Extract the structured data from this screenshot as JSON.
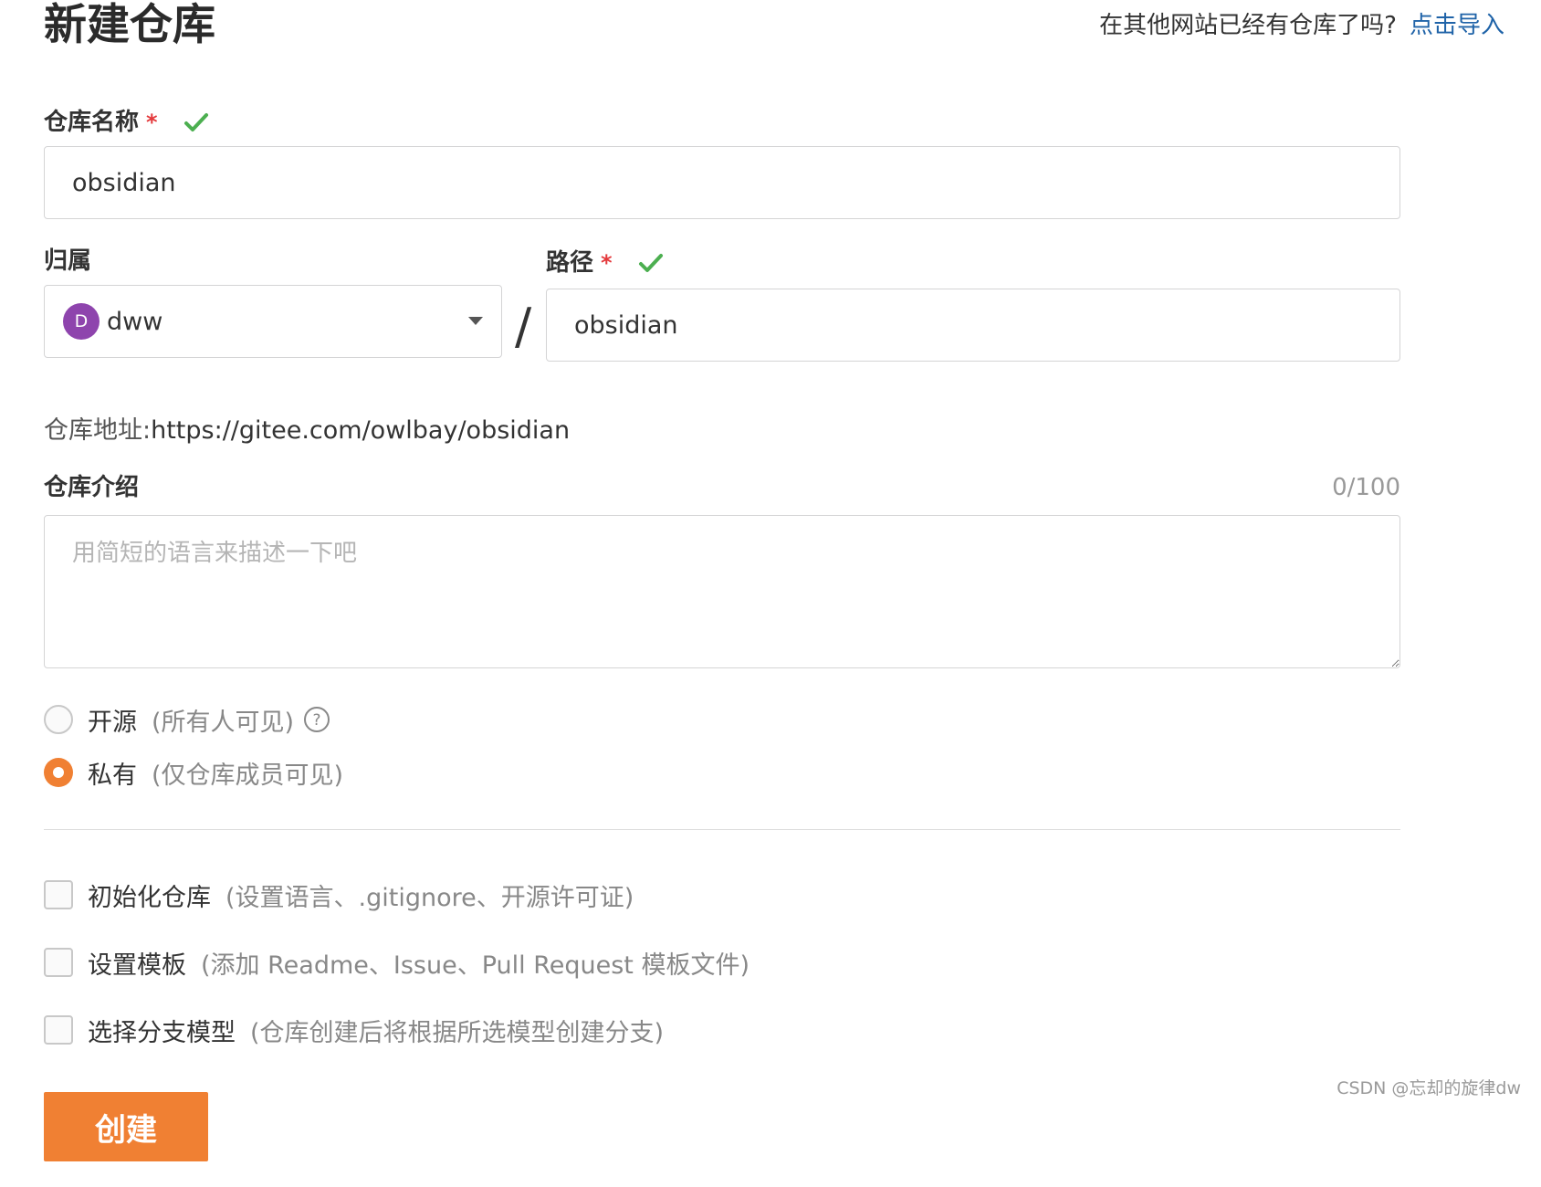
{
  "header": {
    "title": "新建仓库",
    "import_question": "在其他网站已经有仓库了吗?",
    "import_link": "点击导入"
  },
  "repo_name": {
    "label": "仓库名称",
    "required_mark": "*",
    "value": "obsidian",
    "valid_icon": "check-icon"
  },
  "owner": {
    "label": "归属",
    "avatar_letter": "D",
    "avatar_color": "#8e44ad",
    "selected": "dww"
  },
  "separator": "/",
  "path": {
    "label": "路径",
    "required_mark": "*",
    "value": "obsidian",
    "valid_icon": "check-icon"
  },
  "repo_address": {
    "label": "仓库地址:",
    "url": "https://gitee.com/owlbay/obsidian"
  },
  "description": {
    "label": "仓库介绍",
    "counter": "0/100",
    "placeholder": "用简短的语言来描述一下吧"
  },
  "visibility": {
    "options": [
      {
        "label": "开源",
        "hint": "(所有人可见)",
        "checked": false,
        "help_icon": "question-circle-icon"
      },
      {
        "label": "私有",
        "hint": "(仅仓库成员可见)",
        "checked": true
      }
    ]
  },
  "settings": {
    "options": [
      {
        "label": "初始化仓库",
        "hint": "(设置语言、.gitignore、开源许可证)",
        "checked": false
      },
      {
        "label": "设置模板",
        "hint": "(添加 Readme、Issue、Pull Request 模板文件)",
        "checked": false
      },
      {
        "label": "选择分支模型",
        "hint": "(仓库创建后将根据所选模型创建分支)",
        "checked": false
      }
    ]
  },
  "submit": {
    "label": "创建"
  },
  "watermark": "CSDN @忘却的旋律dw",
  "colors": {
    "accent": "#f08033",
    "link": "#1f63a8",
    "valid": "#4caf50",
    "required": "#e4393c"
  }
}
